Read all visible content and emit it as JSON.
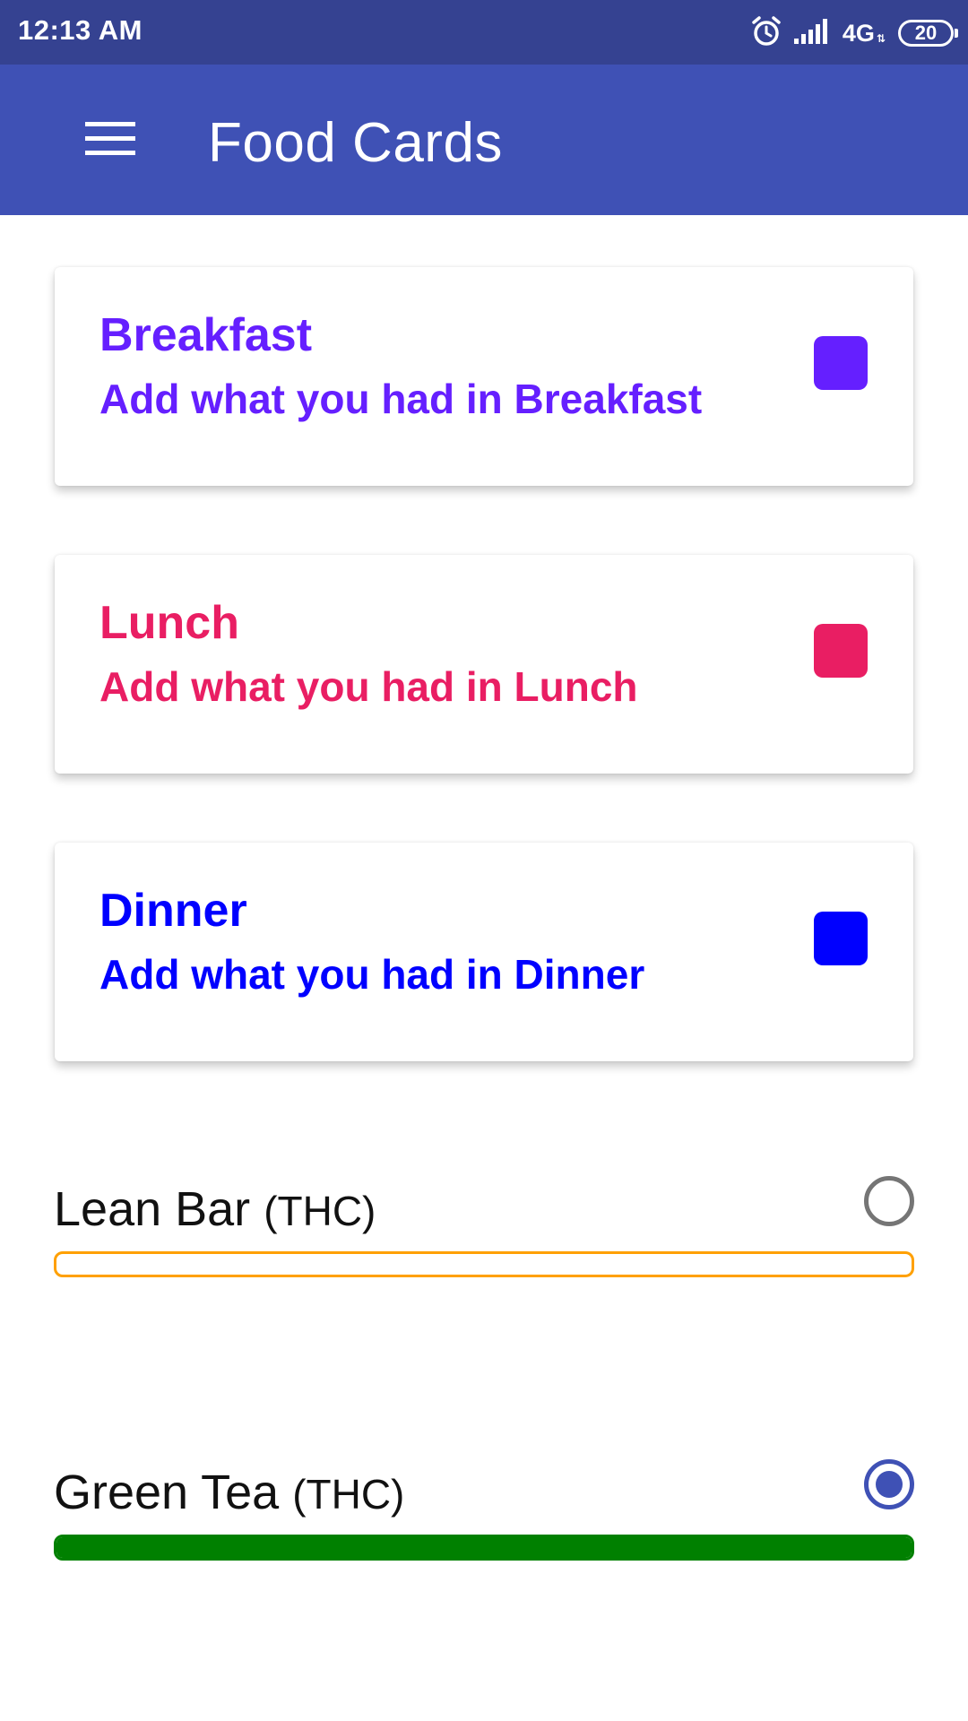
{
  "status_bar": {
    "time": "12:13 AM",
    "network": "4G",
    "battery": "20",
    "icons": [
      "alarm-icon",
      "signal-icon",
      "battery-icon"
    ]
  },
  "app_bar": {
    "title": "Food Cards",
    "menu_icon": "hamburger-menu-icon",
    "color": "#3f51b5"
  },
  "cards": [
    {
      "title": "Breakfast",
      "subtitle": "Add what you had in Breakfast",
      "color": "#651fff"
    },
    {
      "title": "Lunch",
      "subtitle": "Add what you had in Lunch",
      "color": "#e91e63"
    },
    {
      "title": "Dinner",
      "subtitle": "Add what you had in Dinner",
      "color": "#0000ff"
    }
  ],
  "progress_items": [
    {
      "name": "Lean Bar",
      "unit": "(THC)",
      "checked": false,
      "progress": 0,
      "color": "#ffa000"
    },
    {
      "name": "Green Tea",
      "unit": "(THC)",
      "checked": true,
      "progress": 1.0,
      "color": "#008000"
    }
  ]
}
